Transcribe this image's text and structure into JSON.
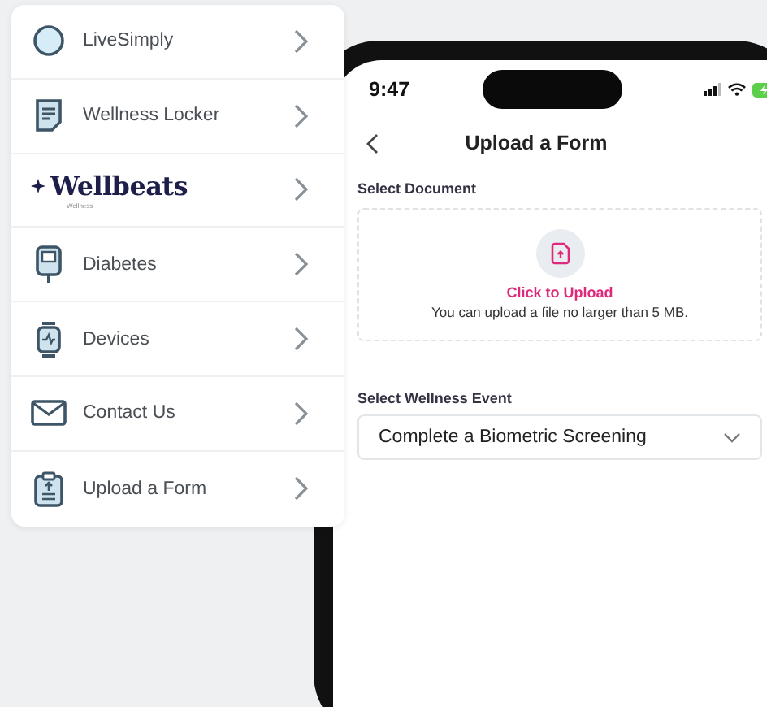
{
  "menu": {
    "items": [
      {
        "kind": "item",
        "label": "LiveSimply"
      },
      {
        "kind": "item",
        "label": "Wellness Locker"
      },
      {
        "kind": "logo",
        "label": "Wellbeats",
        "sublabel": "Wellness"
      },
      {
        "kind": "item",
        "label": "Diabetes"
      },
      {
        "kind": "item",
        "label": "Devices"
      },
      {
        "kind": "item",
        "label": "Contact Us"
      },
      {
        "kind": "item",
        "label": "Upload a Form"
      }
    ]
  },
  "phone": {
    "status_bar": {
      "time": "9:47"
    },
    "title": "Upload a Form",
    "document": {
      "label": "Select Document",
      "action": "Click to Upload",
      "hint": "You can upload a file no larger than 5 MB."
    },
    "event": {
      "label": "Select Wellness Event",
      "value": "Complete a Biometric Screening"
    }
  }
}
